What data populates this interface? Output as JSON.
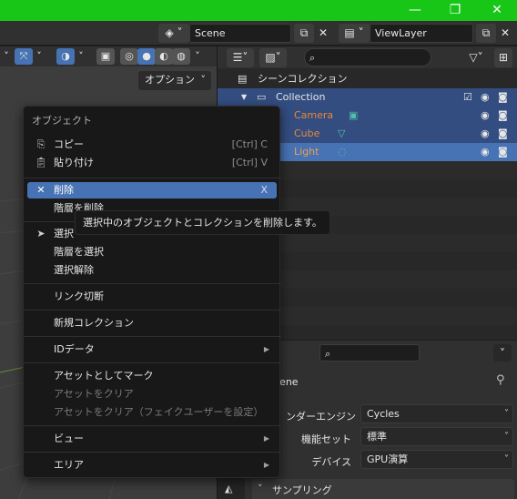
{
  "window": {
    "minimize": "—",
    "restore": "❐",
    "close": "✕"
  },
  "topbar": {
    "scene_value": "Scene",
    "viewlayer_value": "ViewLayer"
  },
  "viewport": {
    "options_label": "オプション"
  },
  "outliner": {
    "search_placeholder": "",
    "root_label": "シーンコレクション",
    "collection_label": "Collection",
    "items": [
      {
        "label": "Camera",
        "color": "#e8883a"
      },
      {
        "label": "Cube",
        "color": "#e8883a"
      },
      {
        "label": "Light",
        "color": "#e8883a"
      }
    ]
  },
  "properties": {
    "scene_label": "cene",
    "render_engine_label": "ンダーエンジン",
    "render_engine_value": "Cycles",
    "feature_set_label": "機能セット",
    "feature_set_value": "標準",
    "device_label": "デバイス",
    "device_value": "GPU演算",
    "section_label": "サンプリング"
  },
  "context_menu": {
    "title": "オブジェクト",
    "copy": {
      "label": "コピー",
      "shortcut": "[Ctrl] C"
    },
    "paste": {
      "label": "貼り付け",
      "shortcut": "[Ctrl] V"
    },
    "delete": {
      "label": "削除",
      "shortcut": "X"
    },
    "delete_hierarchy": "階層を削除",
    "select": "選択",
    "select_hierarchy": "階層を選択",
    "deselect": "選択解除",
    "unlink": "リンク切断",
    "new_collection": "新規コレクション",
    "id_data": "IDデータ",
    "mark_asset": "アセットとしてマーク",
    "clear_asset": "アセットをクリア",
    "clear_asset_fake": "アセットをクリア（フェイクユーザーを設定）",
    "view": "ビュー",
    "area": "エリア"
  },
  "tooltip": "選択中のオブジェクトとコレクションを削除します。",
  "colors": {
    "accent": "#4772b3",
    "titlebar": "#17c617",
    "object_text": "#e8883a"
  }
}
